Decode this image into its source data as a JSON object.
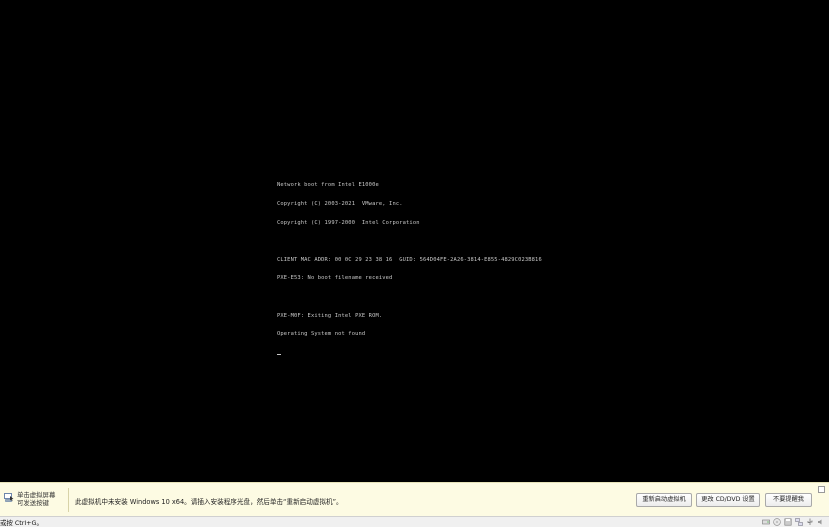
{
  "console": {
    "line1": "Network boot from Intel E1000e",
    "line2": "Copyright (C) 2003-2021  VMware, Inc.",
    "line3": "Copyright (C) 1997-2000  Intel Corporation",
    "line4": "CLIENT MAC ADDR: 00 0C 29 23 38 16  GUID: 564D04FE-2A26-3814-E855-4829C023B816",
    "line5": "PXE-E53: No boot filename received",
    "line6": "PXE-M0F: Exiting Intel PXE ROM.",
    "line7": "Operating System not found"
  },
  "hint": {
    "left_line1": "单击虚拟屏幕",
    "left_line2": "可发送按键",
    "message": "此虚拟机中未安装 Windows 10 x64。请插入安装程序光盘，然后单击“重新启动虚拟机”。",
    "btn_restart": "重新启动虚拟机",
    "btn_change": "更改 CD/DVD 设置",
    "btn_dismiss": "不要提醒我"
  },
  "status": {
    "text": "或按 Ctrl+G。"
  },
  "icons": {
    "hint": "keyboard-click-icon",
    "close": "close-icon",
    "devices": [
      "hard-disk-icon",
      "cd-dvd-icon",
      "floppy-icon",
      "network-icon",
      "usb-icon",
      "sound-icon"
    ]
  }
}
